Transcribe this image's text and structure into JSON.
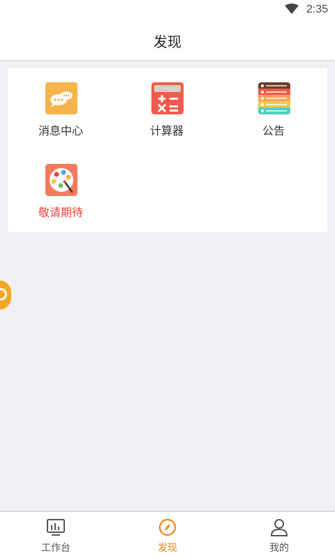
{
  "status_bar": {
    "time": "2:35",
    "wifi_icon": "wifi-icon"
  },
  "header": {
    "title": "发现"
  },
  "grid": {
    "items": [
      {
        "label": "消息中心",
        "icon": "chat-bubbles-icon",
        "color": "#f7b24a"
      },
      {
        "label": "计算器",
        "icon": "calculator-icon",
        "color": "#ef5b4c"
      },
      {
        "label": "公告",
        "icon": "notice-list-icon",
        "color": "#6a3d2f"
      },
      {
        "label": "敬请期待",
        "icon": "palette-icon",
        "color": "#f37b5c",
        "label_color": "#f2453d"
      }
    ]
  },
  "floating_button": {
    "icon": "radio-waves-icon",
    "color": "#f5a623"
  },
  "tab_bar": {
    "tabs": [
      {
        "label": "工作台",
        "icon": "chart-monitor-icon",
        "active": false
      },
      {
        "label": "发现",
        "icon": "compass-icon",
        "active": true
      },
      {
        "label": "我的",
        "icon": "user-icon",
        "active": false
      }
    ],
    "active_color": "#f08519",
    "inactive_color": "#555555"
  }
}
